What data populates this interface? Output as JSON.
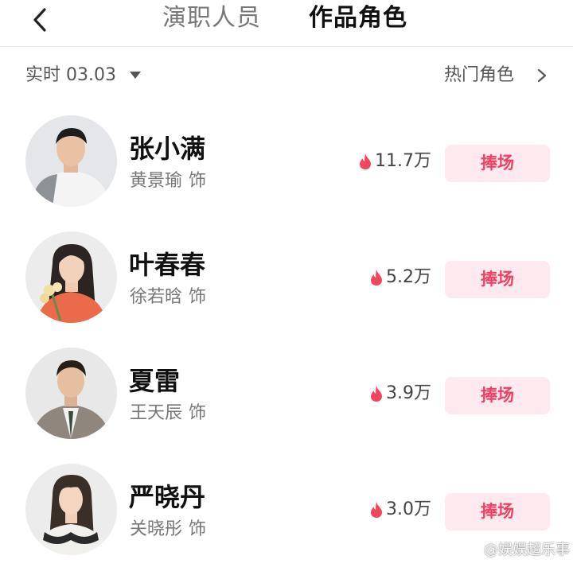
{
  "header": {
    "back_icon": "chevron-left-icon",
    "tabs": [
      {
        "label": "演职人员",
        "active": false
      },
      {
        "label": "作品角色",
        "active": true
      }
    ]
  },
  "filter": {
    "date_label": "实时 03.03",
    "hot_roles_label": "热门角色"
  },
  "roles": [
    {
      "name": "张小满",
      "actor": "黄景瑜",
      "suffix": "饰",
      "heat": "11.7万",
      "button": "捧场"
    },
    {
      "name": "叶春春",
      "actor": "徐若晗",
      "suffix": "饰",
      "heat": "5.2万",
      "button": "捧场"
    },
    {
      "name": "夏雷",
      "actor": "王天辰",
      "suffix": "饰",
      "heat": "3.9万",
      "button": "捧场"
    },
    {
      "name": "严晓丹",
      "actor": "关晓彤",
      "suffix": "饰",
      "heat": "3.0万",
      "button": "捧场"
    }
  ],
  "watermark": "@娱娱超乐事",
  "colors": {
    "accent": "#ef3f62",
    "button_bg": "#fde9ee",
    "flame": "#f0475e"
  }
}
